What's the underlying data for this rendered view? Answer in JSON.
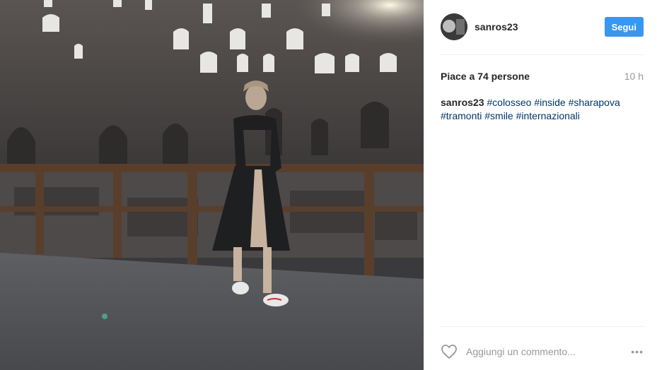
{
  "photo": {
    "description_icon": "photo"
  },
  "header": {
    "username": "sanros23",
    "follow_label": "Segui"
  },
  "likes": {
    "text": "Piace a 74 persone",
    "time": "10 h"
  },
  "caption": {
    "username": "sanros23",
    "hashtags": [
      "#colosseo",
      "#inside",
      "#sharapova",
      "#tramonti",
      "#smile",
      "#internazionali"
    ]
  },
  "comment": {
    "placeholder": "Aggiungi un commento...",
    "more": "•••"
  },
  "colors": {
    "accent": "#3897f0",
    "hashtag": "#003569"
  }
}
